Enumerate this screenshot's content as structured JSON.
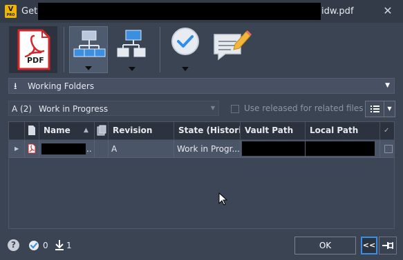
{
  "window": {
    "title_prefix": "Get",
    "title_suffix": "idw.pdf",
    "close_glyph": "✕"
  },
  "toolbar": {
    "pdf_label": "PDF",
    "buttons": [
      "pdf-format",
      "structure-view-selected",
      "structure-view-alt",
      "check-status",
      "comment"
    ]
  },
  "working_folders": {
    "label": "Working Folders",
    "caret": "▼"
  },
  "filter": {
    "revision_key": "A (2)",
    "revision_value": "Work in Progress",
    "use_released_label": "Use released for related files",
    "use_released_checked": false
  },
  "grid": {
    "columns": [
      "Name",
      "Revision",
      "State (Histori...",
      "Vault Path",
      "Local Path"
    ],
    "rows": [
      {
        "revision": "A",
        "state": "Work in Progr...",
        "name_suffix": ".."
      }
    ]
  },
  "footer": {
    "help_glyph": "?",
    "checked_count": "0",
    "download_count": "1",
    "ok_label": "OK",
    "collapse_label": "<<"
  },
  "colors": {
    "background": "#3b4453",
    "accent": "#2f8ee8",
    "pdf_red": "#d6262b"
  }
}
